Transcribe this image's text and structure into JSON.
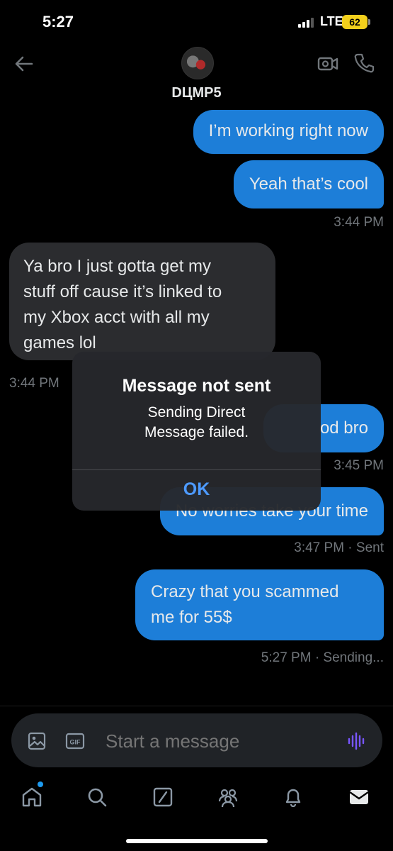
{
  "status_bar": {
    "time": "5:27",
    "network": "LTE",
    "battery": "62"
  },
  "header": {
    "username": "DЦMP5"
  },
  "messages": [
    {
      "text": "I’m working right now"
    },
    {
      "text": "Yeah that’s cool",
      "time": "3:44 PM"
    },
    {
      "lines": [
        "Ya bro I just gotta get my",
        "stuff off cause it’s linked to",
        "my Xbox acct with all my",
        "games lol"
      ],
      "time": "3:44 PM"
    },
    {
      "text": "od bro",
      "time": "3:45 PM"
    },
    {
      "text": "No worries take your time",
      "time": "3:47 PM · Sent"
    },
    {
      "lines": [
        "Crazy that you scammed",
        "me for 55$"
      ],
      "time": "5:27 PM · Sending..."
    }
  ],
  "alert": {
    "title": "Message not sent",
    "message_lines": [
      "Sending Direct",
      "Message failed."
    ],
    "ok_label": "OK"
  },
  "composer": {
    "placeholder": "Start a message"
  },
  "icons": {
    "back": "back-arrow-icon",
    "video": "video-call-icon",
    "phone": "phone-call-icon",
    "image": "image-icon",
    "gif": "gif-icon",
    "voice": "voice-icon",
    "home": "home-icon",
    "search": "search-icon",
    "grok": "grok-icon",
    "communities": "communities-icon",
    "notifications": "notifications-icon",
    "messages": "messages-icon"
  },
  "colors": {
    "accent": "#1d9bf0",
    "sent_bubble": "#1d7ed8",
    "received_bubble": "#2b2c2f",
    "alert_ok": "#4d9aff"
  }
}
